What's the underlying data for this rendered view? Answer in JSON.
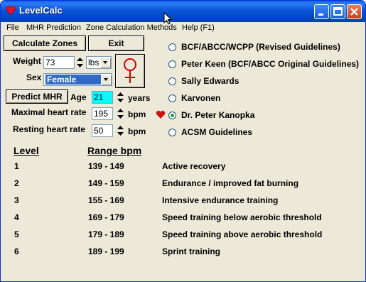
{
  "window": {
    "title": "LevelCalc"
  },
  "menu": [
    "File",
    "MHR Prediction",
    "Zone Calculation Methods",
    "Help (F1)"
  ],
  "toolbar": {
    "calculate_label": "Calculate Zones",
    "exit_label": "Exit",
    "predict_label": "Predict MHR"
  },
  "form": {
    "weight_label": "Weight",
    "weight_value": "73",
    "weight_unit": "lbs",
    "sex_label": "Sex",
    "sex_value": "Female",
    "age_label": "Age",
    "age_value": "21",
    "age_unit": "years",
    "mhr_label": "Maximal heart rate",
    "mhr_value": "195",
    "mhr_unit": "bpm",
    "rhr_label": "Resting heart rate",
    "rhr_value": "50",
    "rhr_unit": "bpm"
  },
  "methods": [
    {
      "label": "BCF/ABCC/WCPP (Revised Guidelines)",
      "checked": false
    },
    {
      "label": "Peter Keen (BCF/ABCC Original Guidelines)",
      "checked": false
    },
    {
      "label": "Sally Edwards",
      "checked": false
    },
    {
      "label": "Karvonen",
      "checked": false
    },
    {
      "label": "Dr. Peter Kanopka",
      "checked": true
    },
    {
      "label": "ACSM Guidelines",
      "checked": false
    }
  ],
  "table": {
    "headers": [
      "Level",
      "Range bpm"
    ],
    "rows": [
      {
        "level": "1",
        "range": "139 - 149",
        "desc": "Active recovery"
      },
      {
        "level": "2",
        "range": "149 - 159",
        "desc": "Endurance / improved fat burning"
      },
      {
        "level": "3",
        "range": "155 - 169",
        "desc": "Intensive endurance training"
      },
      {
        "level": "4",
        "range": "169 - 179",
        "desc": "Speed training below aerobic threshold"
      },
      {
        "level": "5",
        "range": "179 - 189",
        "desc": "Speed training above aerobic threshold"
      },
      {
        "level": "6",
        "range": "189 - 199",
        "desc": "Sprint training"
      }
    ]
  },
  "colors": {
    "heart": "#cc1111",
    "age_bg": "#00ffff",
    "female_symbol": "#cc0000"
  }
}
